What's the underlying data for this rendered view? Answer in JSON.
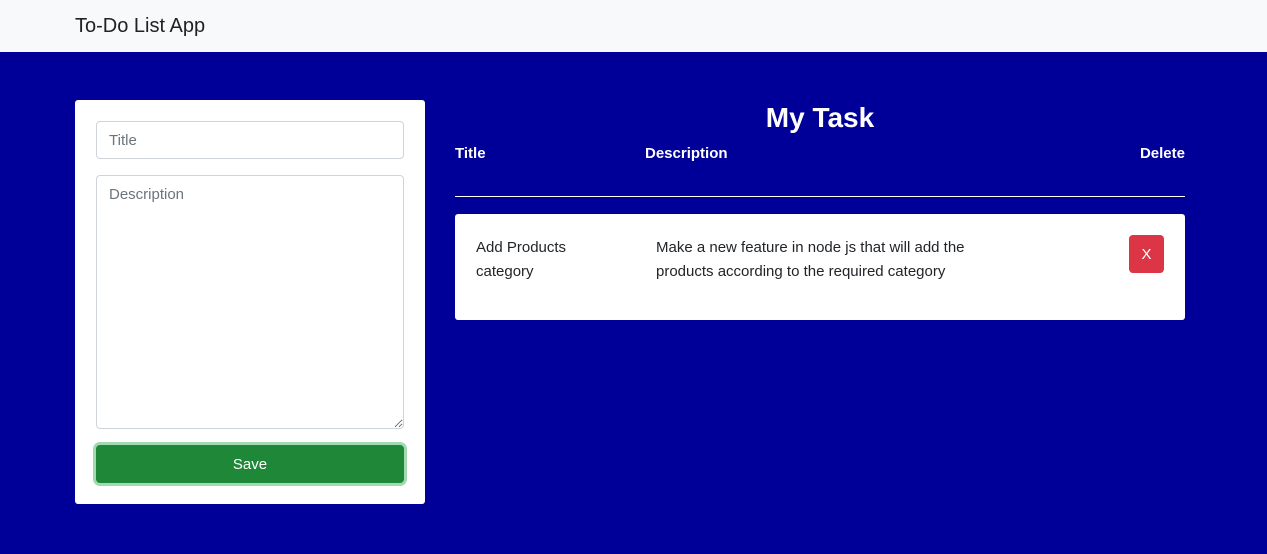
{
  "navbar": {
    "brand": "To-Do List App"
  },
  "form": {
    "title_placeholder": "Title",
    "description_placeholder": "Description",
    "title_value": "",
    "description_value": "",
    "save_label": "Save"
  },
  "tasks_section": {
    "heading": "My Task",
    "columns": {
      "title": "Title",
      "description": "Description",
      "delete": "Delete"
    },
    "tasks": [
      {
        "title": "Add Products category",
        "description": "Make a new feature in node js that will add the products according to the required category",
        "delete_label": "X"
      }
    ]
  },
  "colors": {
    "background": "#000099",
    "navbar": "#f8f9fa",
    "save_button": "#1f8838",
    "delete_button": "#dc3545"
  }
}
